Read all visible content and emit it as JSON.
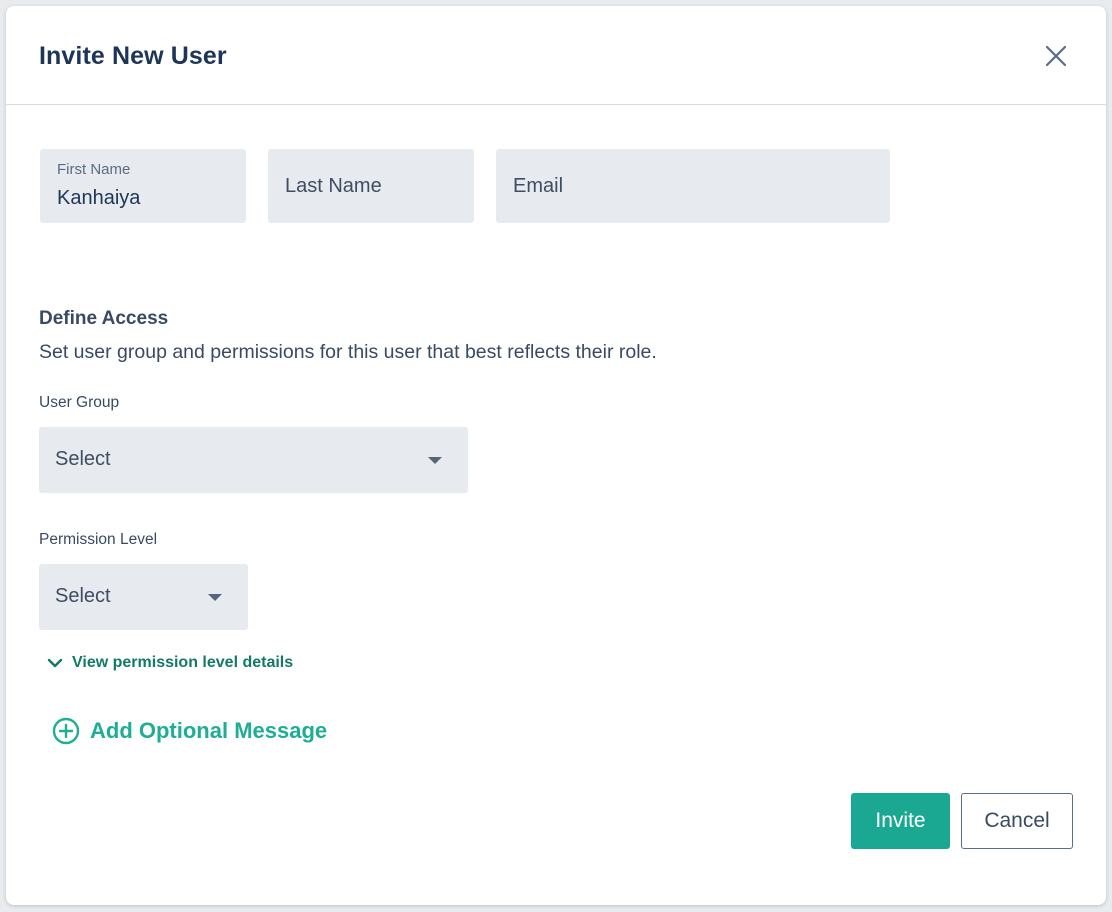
{
  "modal": {
    "title": "Invite New User",
    "close_icon": "close-icon"
  },
  "form": {
    "first_name": {
      "label": "First Name",
      "value": "Kanhaiya"
    },
    "last_name": {
      "placeholder": "Last Name"
    },
    "email": {
      "placeholder": "Email"
    }
  },
  "access": {
    "title": "Define Access",
    "description": "Set user group and permissions for this user that best reflects their role.",
    "user_group": {
      "label": "User Group",
      "selected": "Select"
    },
    "permission_level": {
      "label": "Permission Level",
      "selected": "Select"
    },
    "details_link": "View permission level details"
  },
  "optional_message": {
    "label": "Add Optional Message",
    "icon": "plus-circle-icon"
  },
  "footer": {
    "invite_label": "Invite",
    "cancel_label": "Cancel"
  },
  "colors": {
    "primary": "#1aa892",
    "link": "#137a66",
    "heading": "#1d3557",
    "field_bg": "#e7eaef"
  }
}
